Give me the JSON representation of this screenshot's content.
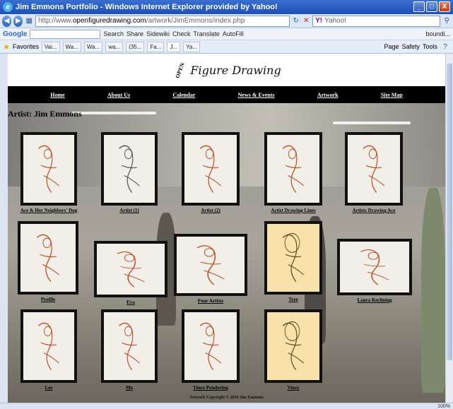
{
  "window": {
    "title": "Jim Emmons Portfolio - Windows Internet Explorer provided by Yahoo!",
    "minimize": "_",
    "maximize": "□",
    "close": "X"
  },
  "address": {
    "url_prefix": "http://www.",
    "url_domain": "openfiguredrawing.com",
    "url_path": "/artwork/JimEmmons/index.php",
    "search_text": "Yahoo!"
  },
  "googlebar": {
    "logo": "Google",
    "search": "Search",
    "share": "Share",
    "sidewiki": "Sidewiki",
    "check": "Check",
    "translate": "Translate",
    "autofill": "AutoFill",
    "signin": "boundi..."
  },
  "favbar": {
    "favorites": "Favorites",
    "tabs": [
      "Vai...",
      "Wa...",
      "Wa...",
      "wa...",
      "(35...",
      "Fa...",
      "J...",
      "Ya..."
    ],
    "page": "Page",
    "safety": "Safety",
    "tools": "Tools"
  },
  "site": {
    "logo_open": "OPEN",
    "logo_text": "Figure Drawing",
    "nav": [
      "Home",
      "About Us",
      "Calendar",
      "News & Events",
      "Artwork",
      "Site Map"
    ],
    "heading": "Artist: Jim Emmons",
    "copyright": "Artwork Copyright © 2010 Jim Emmons"
  },
  "artworks": [
    {
      "caption": "Ace & Her Neighbors' Dog",
      "tone": "red"
    },
    {
      "caption": "Artist (1)",
      "tone": "grey"
    },
    {
      "caption": "Artist (2)",
      "tone": "red"
    },
    {
      "caption": "Artist Drawing Lines",
      "tone": "red"
    },
    {
      "caption": "Artists Drawing Ace",
      "tone": "red"
    },
    {
      "caption": "Profile",
      "tone": "red"
    },
    {
      "caption": "Eva",
      "tone": "red"
    },
    {
      "caption": "Four Artists",
      "tone": "red"
    },
    {
      "caption": "Tree",
      "tone": "yellow"
    },
    {
      "caption": "Laura Reclining",
      "tone": "red"
    },
    {
      "caption": "Lee",
      "tone": "red"
    },
    {
      "caption": "Mo",
      "tone": "red"
    },
    {
      "caption": "Vince Pondering",
      "tone": "red"
    },
    {
      "caption": "Vince",
      "tone": "yellow"
    }
  ],
  "status": {
    "zoom": "100%"
  }
}
